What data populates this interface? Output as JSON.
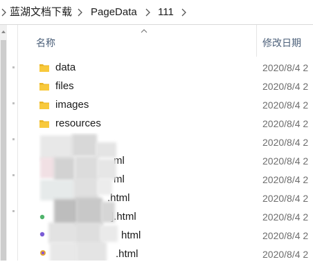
{
  "breadcrumb": {
    "items": [
      "蓝湖文档下载",
      "PageData",
      "111"
    ]
  },
  "columns": {
    "name": "名称",
    "date": "修改日期"
  },
  "files": [
    {
      "name": "data",
      "date": "2020/8/4 2",
      "icon": "folder-icon"
    },
    {
      "name": "files",
      "date": "2020/8/4 2",
      "icon": "folder-icon"
    },
    {
      "name": "images",
      "date": "2020/8/4 2",
      "icon": "folder-icon"
    },
    {
      "name": "resources",
      "date": "2020/8/4 2",
      "icon": "folder-icon"
    },
    {
      "name": "",
      "date": "2020/8/4 2",
      "icon": "html-file-icon"
    },
    {
      "name": "ml",
      "date": "2020/8/4 2",
      "icon": "html-file-icon"
    },
    {
      "name": "ml",
      "date": "2020/8/4 2",
      "icon": "html-file-icon"
    },
    {
      "name": ".html",
      "date": "2020/8/4 2",
      "icon": "html-file-icon"
    },
    {
      "name": "].html",
      "date": "2020/8/4 2",
      "icon": "html-file-icon"
    },
    {
      "name": "html",
      "date": "2020/8/4 2",
      "icon": "html-file-icon"
    },
    {
      "name": ".html",
      "date": "2020/8/4 2",
      "icon": "html-file-icon"
    }
  ],
  "colors": {
    "folder": "#f8c93c",
    "header_text": "#4c607a"
  }
}
